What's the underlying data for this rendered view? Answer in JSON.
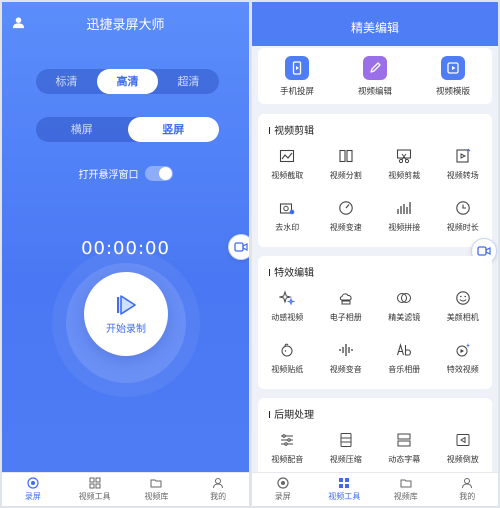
{
  "left": {
    "title": "迅捷录屏大师",
    "quality_options": [
      "标清",
      "高清",
      "超清"
    ],
    "quality_selected": "高清",
    "orientation_options": [
      "横屏",
      "竖屏"
    ],
    "orientation_selected": "竖屏",
    "float_window_label": "打开悬浮窗口",
    "float_window_on": true,
    "timer": "00:00:00",
    "record_label": "开始录制",
    "tabs": [
      "录屏",
      "视频工具",
      "视频库",
      "我的"
    ],
    "active_tab": "录屏"
  },
  "right": {
    "title": "精美编辑",
    "top_items": [
      {
        "label": "手机投屏",
        "icon": "phone-cast-icon"
      },
      {
        "label": "视频编辑",
        "icon": "pen-icon"
      },
      {
        "label": "视频模版",
        "icon": "play-template-icon"
      }
    ],
    "sections": [
      {
        "title": "I 视频剪辑",
        "items": [
          {
            "label": "视频截取",
            "icon": "crop-image-icon"
          },
          {
            "label": "视频分割",
            "icon": "split-icon"
          },
          {
            "label": "视频剪裁",
            "icon": "cut-icon"
          },
          {
            "label": "视频转场",
            "icon": "transition-icon"
          },
          {
            "label": "去水印",
            "icon": "watermark-icon"
          },
          {
            "label": "视频变速",
            "icon": "speed-icon"
          },
          {
            "label": "视频拼接",
            "icon": "join-icon"
          },
          {
            "label": "视频时长",
            "icon": "clock-icon"
          }
        ]
      },
      {
        "title": "I 特效编辑",
        "items": [
          {
            "label": "动感视频",
            "icon": "sparkle-icon"
          },
          {
            "label": "电子相册",
            "icon": "cloud-album-icon"
          },
          {
            "label": "精美滤镜",
            "icon": "filter-icon"
          },
          {
            "label": "美颜相机",
            "icon": "face-icon"
          },
          {
            "label": "视频贴纸",
            "icon": "sticker-icon"
          },
          {
            "label": "视频变音",
            "icon": "audio-wave-icon"
          },
          {
            "label": "音乐相册",
            "icon": "music-text-icon"
          },
          {
            "label": "特效视频",
            "icon": "effect-icon"
          }
        ]
      },
      {
        "title": "I 后期处理",
        "items": [
          {
            "label": "视频配音",
            "icon": "dubbing-icon"
          },
          {
            "label": "视频压缩",
            "icon": "compress-icon"
          },
          {
            "label": "动态字幕",
            "icon": "subtitle-icon"
          },
          {
            "label": "视频倒放",
            "icon": "reverse-icon"
          }
        ]
      }
    ],
    "tabs": [
      "录屏",
      "视频工具",
      "视频库",
      "我的"
    ],
    "active_tab": "视频工具"
  },
  "colors": {
    "accent": "#3e6cf0",
    "header_blue": "#4f7df5",
    "purple": "#9b6fe8"
  }
}
